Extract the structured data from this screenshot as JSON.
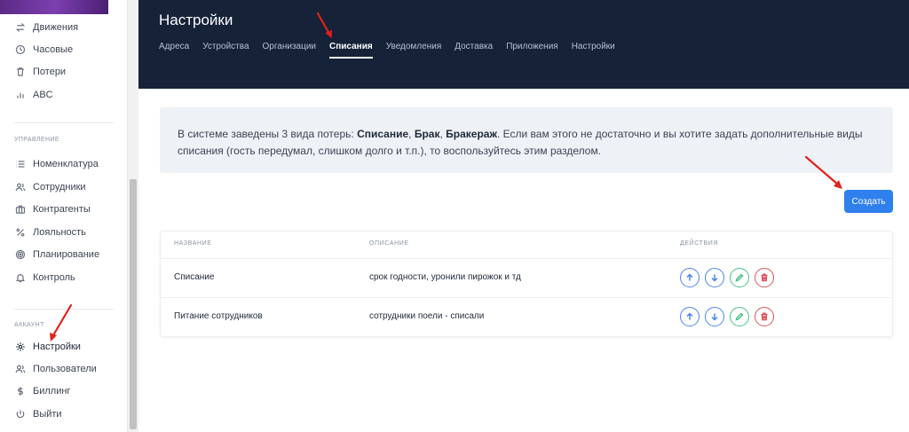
{
  "sidebar": {
    "items_top": [
      {
        "label": "Движения",
        "icon": "arrows-swap-icon"
      },
      {
        "label": "Часовые",
        "icon": "clock-icon"
      },
      {
        "label": "Потери",
        "icon": "trash-icon"
      },
      {
        "label": "ABC",
        "icon": "bar-chart-icon"
      }
    ],
    "section_manage": "Управление",
    "items_manage": [
      {
        "label": "Номенклатура",
        "icon": "list-icon"
      },
      {
        "label": "Сотрудники",
        "icon": "users-icon"
      },
      {
        "label": "Контрагенты",
        "icon": "briefcase-icon"
      },
      {
        "label": "Лояльность",
        "icon": "percent-icon"
      },
      {
        "label": "Планирование",
        "icon": "target-icon"
      },
      {
        "label": "Контроль",
        "icon": "bell-icon"
      }
    ],
    "section_account": "Аккаунт",
    "items_account": [
      {
        "label": "Настройки",
        "icon": "gear-icon",
        "active": true
      },
      {
        "label": "Пользователи",
        "icon": "users-icon"
      },
      {
        "label": "Биллинг",
        "icon": "dollar-icon"
      },
      {
        "label": "Выйти",
        "icon": "power-icon"
      }
    ]
  },
  "header": {
    "title": "Настройки",
    "tabs": [
      {
        "label": "Адреса"
      },
      {
        "label": "Устройства"
      },
      {
        "label": "Организации"
      },
      {
        "label": "Списания",
        "active": true
      },
      {
        "label": "Уведомления"
      },
      {
        "label": "Доставка"
      },
      {
        "label": "Приложения"
      },
      {
        "label": "Настройки"
      }
    ]
  },
  "info": {
    "prefix": "В системе заведены 3 вида потерь: ",
    "b1": "Списание",
    "sep1": ", ",
    "b2": "Брак",
    "sep2": ", ",
    "b3": "Бракераж",
    "suffix": ". Если вам этого не достаточно и вы хотите задать дополнительные виды списания (гость передумал, слишком долго и т.п.), то воспользуйтесь этим разделом."
  },
  "create_button": "Создать",
  "table": {
    "columns": [
      "Название",
      "Описание",
      "Действия"
    ],
    "rows": [
      {
        "name": "Списание",
        "description": "срок годности, уронили пирожок и тд"
      },
      {
        "name": "Питание сотрудников",
        "description": "сотрудники поели - списали"
      }
    ]
  },
  "colors": {
    "header_bg": "#162238",
    "accent": "#2f80ed",
    "info_bg": "#eef2f7",
    "arrow": "#e5201c"
  }
}
